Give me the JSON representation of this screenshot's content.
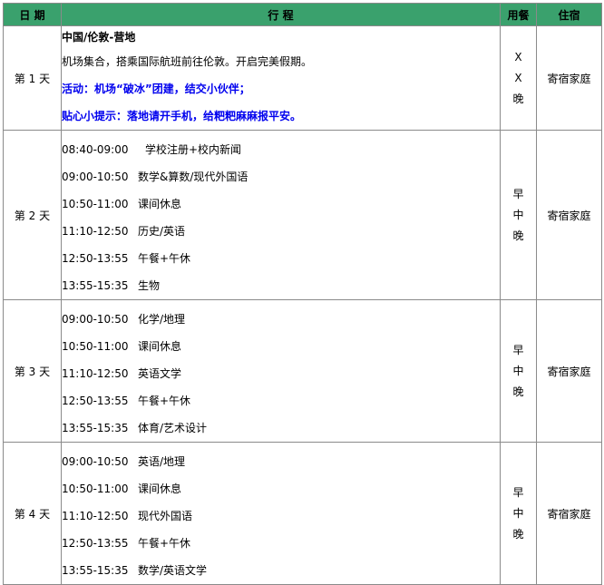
{
  "header": {
    "date": "日  期",
    "schedule": "行        程",
    "meal": "用餐",
    "stay": "住宿"
  },
  "days": [
    {
      "day": "第 1 天",
      "intro": [
        {
          "text": "中国/伦敦-营地",
          "style": "bold"
        },
        {
          "text": "机场集合，搭乘国际航班前往伦敦。开启完美假期。",
          "style": "normal"
        },
        {
          "text": "活动：机场“破冰”团建，结交小伙伴；",
          "style": "blue"
        },
        {
          "text": "贴心小提示：落地请开手机，给粑粑麻麻报平安。",
          "style": "blue"
        }
      ],
      "meals": [
        "X",
        "X",
        "晚"
      ],
      "stay": "寄宿家庭"
    },
    {
      "day": "第 2 天",
      "items": [
        {
          "time": "08:40-09:00",
          "activity": "学校注册+校内新闻"
        },
        {
          "time": "09:00-10:50",
          "activity": "数学&算数/现代外国语"
        },
        {
          "time": "10:50-11:00",
          "activity": "课间休息"
        },
        {
          "time": "11:10-12:50",
          "activity": "历史/英语"
        },
        {
          "time": "12:50-13:55",
          "activity": "午餐+午休"
        },
        {
          "time": "13:55-15:35",
          "activity": "生物"
        }
      ],
      "meals": [
        "早",
        "中",
        "晚"
      ],
      "stay": "寄宿家庭"
    },
    {
      "day": "第 3 天",
      "items": [
        {
          "time": "09:00-10:50",
          "activity": "化学/地理"
        },
        {
          "time": "10:50-11:00",
          "activity": "课间休息"
        },
        {
          "time": "11:10-12:50",
          "activity": "英语文学"
        },
        {
          "time": "12:50-13:55",
          "activity": "午餐+午休"
        },
        {
          "time": "13:55-15:35",
          "activity": "体育/艺术设计"
        }
      ],
      "meals": [
        "早",
        "中",
        "晚"
      ],
      "stay": "寄宿家庭"
    },
    {
      "day": "第 4 天",
      "items": [
        {
          "time": "09:00-10:50",
          "activity": "英语/地理"
        },
        {
          "time": "10:50-11:00",
          "activity": "课间休息"
        },
        {
          "time": "11:10-12:50",
          "activity": "现代外国语"
        },
        {
          "time": "12:50-13:55",
          "activity": "午餐+午休"
        },
        {
          "time": "13:55-15:35",
          "activity": "数学/英语文学"
        }
      ],
      "meals": [
        "早",
        "中",
        "晚"
      ],
      "stay": "寄宿家庭"
    }
  ]
}
